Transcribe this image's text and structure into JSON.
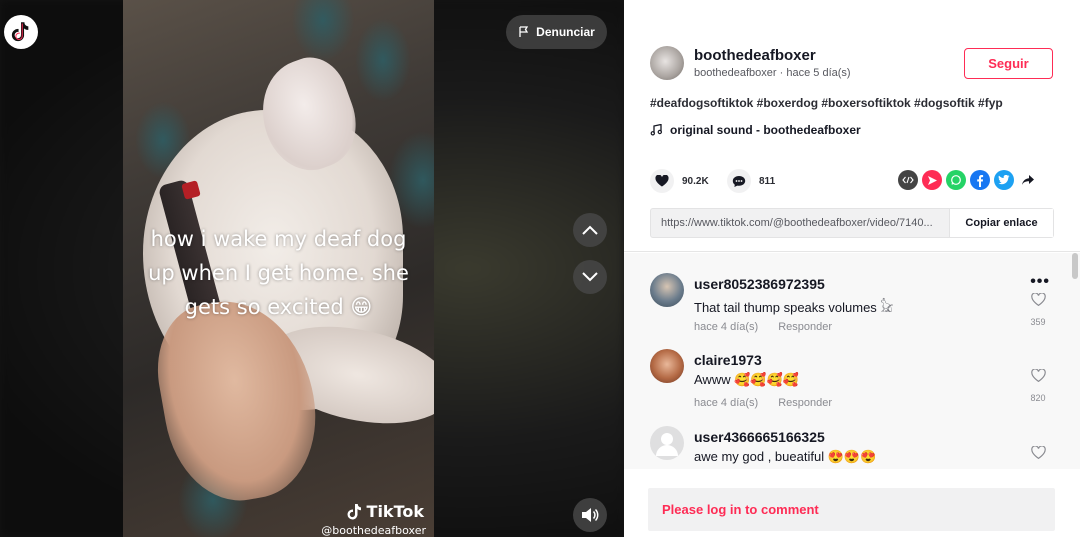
{
  "video": {
    "caption_line1": "how i wake my deaf dog",
    "caption_line2": "up when I get home. she",
    "caption_line3": "gets so excited",
    "caption_emoji": "😁",
    "watermark_brand": "TikTok",
    "watermark_handle": "@boothedeafboxer",
    "report_label": "Denunciar"
  },
  "author": {
    "username": "boothedeafboxer",
    "handle": "boothedeafboxer",
    "separator": "·",
    "posted": "hace 5 día(s)",
    "follow_label": "Seguir"
  },
  "post": {
    "hashtags": "#deafdogsoftiktok #boxerdog #boxersoftiktok #dogsoftik #fyp",
    "sound": "original sound - boothedeafboxer",
    "likes": "90.2K",
    "comments": "811",
    "link": "https://www.tiktok.com/@boothedeafboxer/video/7140...",
    "copy_label": "Copiar enlace"
  },
  "comments": [
    {
      "name": "user8052386972395",
      "text": "That tail thump speaks volumes 𓃠",
      "time": "hace 4 día(s)",
      "reply": "Responder",
      "likes": "359"
    },
    {
      "name": "claire1973",
      "text": "Awww 🥰🥰🥰🥰",
      "time": "hace 4 día(s)",
      "reply": "Responder",
      "likes": "820"
    },
    {
      "name": "user4366665166325",
      "text": "awe my god , bueatiful 😍😍😍",
      "time": "",
      "reply": "",
      "likes": ""
    }
  ],
  "comment_more": "•••",
  "login_prompt": "Please log in to comment",
  "colors": {
    "accent": "#fe2c55",
    "whatsapp": "#25d366",
    "facebook": "#1877f2",
    "twitter": "#1da1f2",
    "embed": "#444444"
  }
}
